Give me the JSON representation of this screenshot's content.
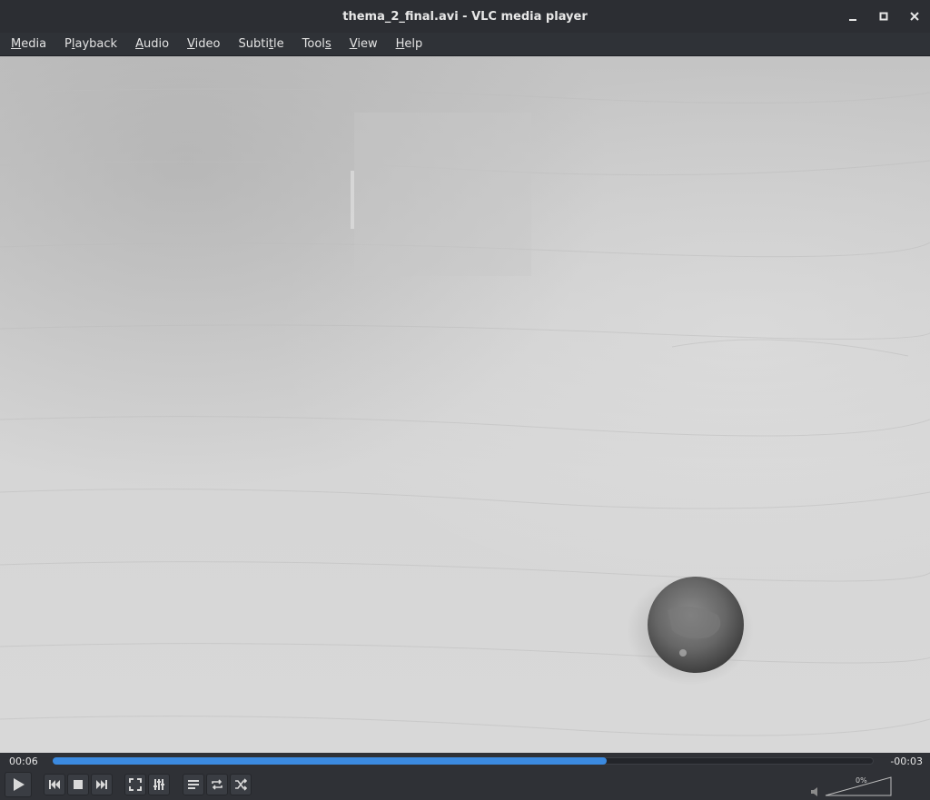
{
  "window": {
    "title": "thema_2_final.avi - VLC media player"
  },
  "menu": [
    {
      "pre": "",
      "key": "M",
      "post": "edia"
    },
    {
      "pre": "P",
      "key": "l",
      "post": "ayback"
    },
    {
      "pre": "",
      "key": "A",
      "post": "udio"
    },
    {
      "pre": "",
      "key": "V",
      "post": "ideo"
    },
    {
      "pre": "Subti",
      "key": "t",
      "post": "le"
    },
    {
      "pre": "Tool",
      "key": "s",
      "post": ""
    },
    {
      "pre": "",
      "key": "V",
      "post": "iew"
    },
    {
      "pre": "",
      "key": "H",
      "post": "elp"
    }
  ],
  "playback": {
    "elapsed": "00:06",
    "remaining": "-00:03",
    "progress_fraction": 0.675
  },
  "volume": {
    "label": "0%",
    "level_fraction": 0.0
  },
  "colors": {
    "accent": "#3b8ae0",
    "background": "#2f3136"
  },
  "icons": {
    "play": "play-icon",
    "previous": "previous-icon",
    "stop": "stop-icon",
    "next": "next-icon",
    "fullscreen": "fullscreen-icon",
    "extended_settings": "equalizer-icon",
    "playlist": "playlist-icon",
    "loop": "loop-icon",
    "random": "shuffle-icon",
    "volume": "speaker-icon"
  }
}
